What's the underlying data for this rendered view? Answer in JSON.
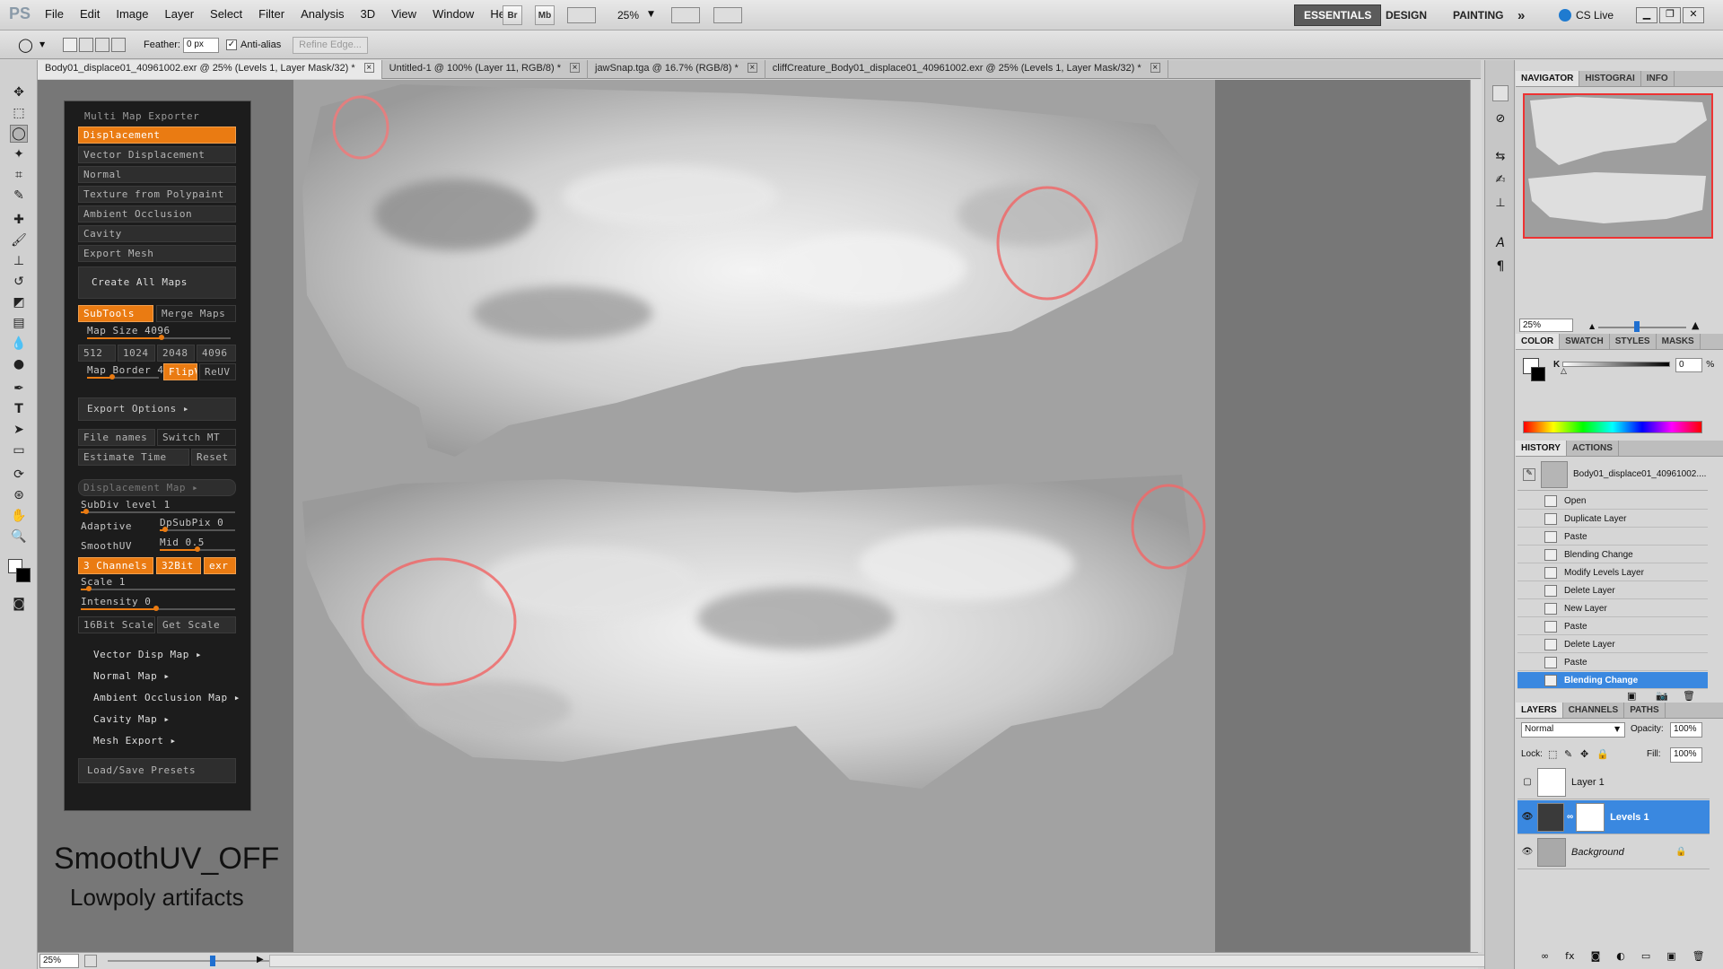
{
  "app": {
    "logo": "PS"
  },
  "menu": [
    "File",
    "Edit",
    "Image",
    "Layer",
    "Select",
    "Filter",
    "Analysis",
    "3D",
    "View",
    "Window",
    "Help"
  ],
  "app_bar": {
    "bridge": "Br",
    "minibridge": "Mb",
    "zoom": "25%"
  },
  "workspaces": {
    "essentials": "ESSENTIALS",
    "design": "DESIGN",
    "painting": "PAINTING",
    "more": "»",
    "cslive": "CS Live"
  },
  "options": {
    "feather_label": "Feather:",
    "feather_value": "0 px",
    "antialias": "Anti-alias",
    "refine": "Refine Edge..."
  },
  "tabs": [
    {
      "label": "Body01_displace01_40961002.exr @ 25% (Levels 1, Layer Mask/32) *",
      "active": true
    },
    {
      "label": "Untitled-1 @ 100% (Layer 11, RGB/8) *",
      "active": false
    },
    {
      "label": "jawSnap.tga @ 16.7% (RGB/8) *",
      "active": false
    },
    {
      "label": "cliffCreature_Body01_displace01_40961002.exr @ 25% (Levels 1, Layer Mask/32) *",
      "active": false
    }
  ],
  "zbrush": {
    "title": "Multi Map Exporter",
    "maps": [
      "Displacement",
      "Vector Displacement",
      "Normal",
      "Texture from Polypaint",
      "Ambient Occlusion",
      "Cavity",
      "Export Mesh"
    ],
    "create_all": "Create All Maps",
    "subtools": "SubTools",
    "merge_maps": "Merge Maps",
    "map_size": "Map Size 4096",
    "sizes": [
      "512",
      "1024",
      "2048",
      "4096"
    ],
    "map_border": "Map Border 4",
    "flipv": "FlipV",
    "reuv": "ReUV",
    "export_options": "Export Options",
    "file_names": "File names",
    "switch_mt": "Switch MT",
    "estimate": "Estimate Time",
    "reset": "Reset",
    "disp_map": "Displacement Map",
    "subdiv": "SubDiv level 1",
    "adaptive": "Adaptive",
    "dpsubpix": "DpSubPix 0",
    "smoothuv": "SmoothUV",
    "mid": "Mid 0.5",
    "channels": "3 Channels",
    "bit": "32Bit",
    "exr": "exr",
    "scale": "Scale 1",
    "intensity": "Intensity 0",
    "bit16": "16Bit Scale",
    "get_scale": "Get Scale",
    "subs": [
      "Vector Disp Map",
      "Normal Map",
      "Ambient Occlusion Map",
      "Cavity Map",
      "Mesh Export"
    ],
    "presets": "Load/Save Presets"
  },
  "caption": {
    "line1": "SmoothUV_OFF",
    "line2": "Lowpoly artifacts"
  },
  "status": {
    "zoom": "25%"
  },
  "navigator": {
    "tabs": [
      "NAVIGATOR",
      "HISTOGRAI",
      "INFO"
    ],
    "zoom": "25%"
  },
  "color": {
    "tabs": [
      "COLOR",
      "SWATCH",
      "STYLES",
      "MASKS"
    ],
    "k_label": "K",
    "k_value": "0",
    "unit": "%"
  },
  "history": {
    "tabs": [
      "HISTORY",
      "ACTIONS"
    ],
    "snapshot": "Body01_displace01_40961002....",
    "items": [
      "Open",
      "Duplicate Layer",
      "Paste",
      "Blending Change",
      "Modify Levels Layer",
      "Delete Layer",
      "New Layer",
      "Paste",
      "Delete Layer",
      "Paste",
      "Blending Change"
    ]
  },
  "layers": {
    "tabs": [
      "LAYERS",
      "CHANNELS",
      "PATHS"
    ],
    "blend": "Normal",
    "opacity_label": "Opacity:",
    "opacity": "100%",
    "lock_label": "Lock:",
    "fill_label": "Fill:",
    "fill": "100%",
    "items": [
      {
        "name": "Layer 1",
        "selected": false
      },
      {
        "name": "Levels 1",
        "selected": true
      },
      {
        "name": "Background",
        "selected": false
      }
    ]
  }
}
